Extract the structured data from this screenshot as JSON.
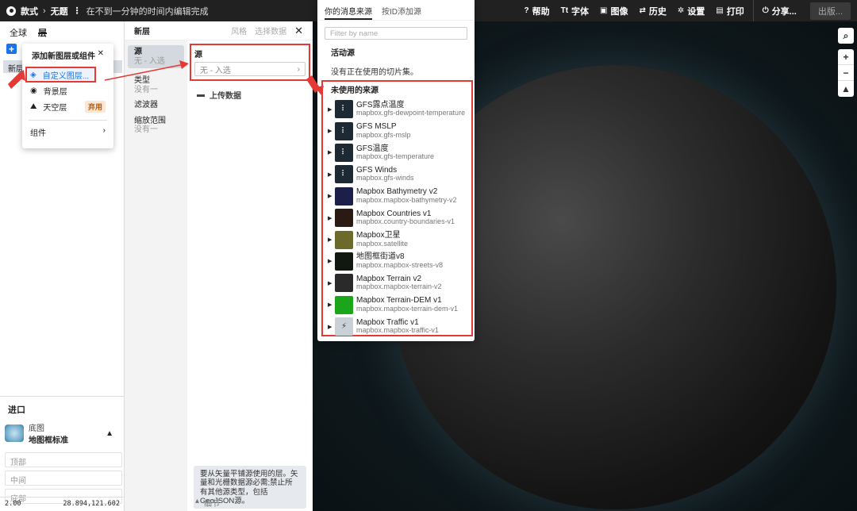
{
  "topbar": {
    "brand": "款式",
    "title": "无题",
    "status": "在不到一分钟的时间内编辑完成",
    "actions": [
      {
        "icon": "help-icon",
        "glyph": "?",
        "label": "帮助"
      },
      {
        "icon": "font-icon",
        "glyph": "Tt",
        "label": "字体"
      },
      {
        "icon": "image-icon",
        "glyph": "▣",
        "label": "图像"
      },
      {
        "icon": "history-icon",
        "glyph": "⇄",
        "label": "历史"
      },
      {
        "icon": "gear-icon",
        "glyph": "✲",
        "label": "设置"
      },
      {
        "icon": "print-icon",
        "glyph": "▤",
        "label": "打印"
      }
    ],
    "share_label": "分享...",
    "publish_label": "出版..."
  },
  "left_panel": {
    "tabs": [
      "全球",
      "层"
    ],
    "layer_row": "新层",
    "import_title": "进口",
    "basemap_label": "底图",
    "basemap_name": "地图框标准",
    "slots": [
      "顶部",
      "中间",
      "底部"
    ],
    "zoom": "2.00",
    "coords": "28.894,121.602"
  },
  "add_menu": {
    "title": "添加新图层或组件",
    "items": [
      {
        "label": "自定义图层...",
        "icon": "layers-icon"
      },
      {
        "label": "背景层",
        "icon": "globe-icon"
      },
      {
        "label": "天空层",
        "icon": "sky-icon",
        "badge": "弃用"
      }
    ],
    "components_label": "组件"
  },
  "layer_editor": {
    "title": "新层",
    "tab_style": "风格",
    "tab_select": "选择数据",
    "sections": [
      {
        "title": "源",
        "sub": "无 - 入选"
      },
      {
        "title": "类型",
        "sub": "没有一"
      },
      {
        "title": "滤波器",
        "sub": ""
      },
      {
        "title": "缩放范围",
        "sub": "没有一"
      }
    ],
    "source_label": "源",
    "source_value": "无 - 入选",
    "upload_label": "上传数据",
    "note": "要从矢量平铺源使用的层。矢量和光栅数据源必需;禁止所有其他源类型，包括GeoJSON源。",
    "details_label": "细节"
  },
  "source_panel": {
    "tabs": [
      "你的消息来源",
      "按ID添加源"
    ],
    "filter_placeholder": "Filter by name",
    "active_title": "活动源",
    "active_empty": "没有正在使用的切片集。",
    "unused_title": "未使用的来源",
    "sources": [
      {
        "name": "GFS露点温度",
        "id": "mapbox.gfs-dewpoint-temperature",
        "thumb": "grid",
        "color": "#1d2a33"
      },
      {
        "name": "GFS MSLP",
        "id": "mapbox.gfs-mslp",
        "thumb": "grid",
        "color": "#1d2a33"
      },
      {
        "name": "GFS温度",
        "id": "mapbox.gfs-temperature",
        "thumb": "grid",
        "color": "#1d2a33"
      },
      {
        "name": "GFS Winds",
        "id": "mapbox.gfs-winds",
        "thumb": "grid",
        "color": "#1d2a33"
      },
      {
        "name": "Mapbox Bathymetry v2",
        "id": "mapbox.mapbox-bathymetry-v2",
        "thumb": "img",
        "color": "#1c1f4a"
      },
      {
        "name": "Mapbox Countries v1",
        "id": "mapbox.country-boundaries-v1",
        "thumb": "img",
        "color": "#2b1a14"
      },
      {
        "name": "Mapbox卫星",
        "id": "mapbox.satellite",
        "thumb": "img",
        "color": "#6b6a2a"
      },
      {
        "name": "地图框街道v8",
        "id": "mapbox.mapbox-streets-v8",
        "thumb": "img",
        "color": "#101810"
      },
      {
        "name": "Mapbox Terrain v2",
        "id": "mapbox.mapbox-terrain-v2",
        "thumb": "img",
        "color": "#2a2a2a"
      },
      {
        "name": "Mapbox Terrain-DEM v1",
        "id": "mapbox.mapbox-terrain-dem-v1",
        "thumb": "img",
        "color": "#1aa51a"
      },
      {
        "name": "Mapbox Traffic v1",
        "id": "mapbox.mapbox-traffic-v1",
        "thumb": "bolt",
        "color": "#c9d0d6"
      }
    ]
  },
  "map_controls": {
    "search": "⌕",
    "zoom_in": "+",
    "zoom_out": "−",
    "compass": "▲"
  },
  "colors": {
    "accent": "#1a73e8",
    "highlight": "#e53935",
    "topbar": "#212121"
  }
}
